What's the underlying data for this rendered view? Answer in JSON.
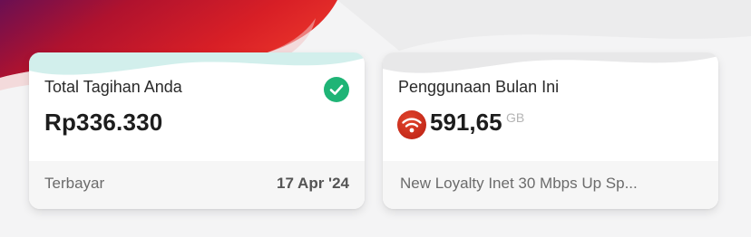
{
  "bill_card": {
    "title": "Total Tagihan Anda",
    "amount": "Rp336.330",
    "status_label": "Terbayar",
    "date": "17 Apr '24",
    "status_icon": "check-circle-icon",
    "status_color": "#1fb476"
  },
  "usage_card": {
    "title": "Penggunaan Bulan Ini",
    "value": "591,65",
    "unit": "GB",
    "package_name": "New Loyalty Inet 30 Mbps Up Sp...",
    "icon": "wifi-icon",
    "icon_color": "#c8241a"
  },
  "theme": {
    "brand_red": "#c41e2a",
    "brand_purple": "#6a0f52",
    "background": "#f4f4f5"
  }
}
